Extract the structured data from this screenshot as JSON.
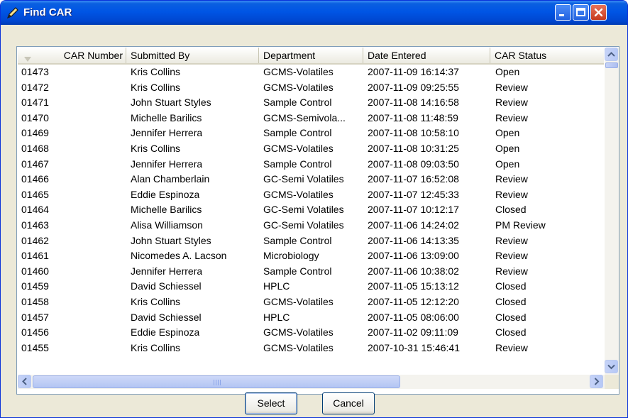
{
  "window": {
    "title": "Find CAR"
  },
  "columns": [
    "CAR Number",
    "Submitted By",
    "Department",
    "Date Entered",
    "CAR Status"
  ],
  "rows": [
    [
      "01473",
      "Kris Collins",
      "GCMS-Volatiles",
      "2007-11-09 16:14:37",
      "Open"
    ],
    [
      "01472",
      "Kris Collins",
      "GCMS-Volatiles",
      "2007-11-09 09:25:55",
      "Review"
    ],
    [
      "01471",
      "John Stuart Styles",
      "Sample Control",
      "2007-11-08 14:16:58",
      "Review"
    ],
    [
      "01470",
      "Michelle Barilics",
      "GCMS-Semivola...",
      "2007-11-08 11:48:59",
      "Review"
    ],
    [
      "01469",
      "Jennifer Herrera",
      "Sample Control",
      "2007-11-08 10:58:10",
      "Open"
    ],
    [
      "01468",
      "Kris Collins",
      "GCMS-Volatiles",
      "2007-11-08 10:31:25",
      "Open"
    ],
    [
      "01467",
      "Jennifer Herrera",
      "Sample Control",
      "2007-11-08 09:03:50",
      "Open"
    ],
    [
      "01466",
      "Alan Chamberlain",
      "GC-Semi Volatiles",
      "2007-11-07 16:52:08",
      "Review"
    ],
    [
      "01465",
      "Eddie Espinoza",
      "GCMS-Volatiles",
      "2007-11-07 12:45:33",
      "Review"
    ],
    [
      "01464",
      "Michelle Barilics",
      "GC-Semi Volatiles",
      "2007-11-07 10:12:17",
      "Closed"
    ],
    [
      "01463",
      "Alisa Williamson",
      "GC-Semi Volatiles",
      "2007-11-06 14:24:02",
      "PM Review"
    ],
    [
      "01462",
      "John Stuart Styles",
      "Sample Control",
      "2007-11-06 14:13:35",
      "Review"
    ],
    [
      "01461",
      "Nicomedes A. Lacson",
      "Microbiology",
      "2007-11-06 13:09:00",
      "Review"
    ],
    [
      "01460",
      "Jennifer Herrera",
      "Sample Control",
      "2007-11-06 10:38:02",
      "Review"
    ],
    [
      "01459",
      "David Schiessel",
      "HPLC",
      "2007-11-05 15:13:12",
      "Closed"
    ],
    [
      "01458",
      "Kris Collins",
      "GCMS-Volatiles",
      "2007-11-05 12:12:20",
      "Closed"
    ],
    [
      "01457",
      "David Schiessel",
      "HPLC",
      "2007-11-05 08:06:00",
      "Closed"
    ],
    [
      "01456",
      "Eddie Espinoza",
      "GCMS-Volatiles",
      "2007-11-02 09:11:09",
      "Closed"
    ],
    [
      "01455",
      "Kris Collins",
      "GCMS-Volatiles",
      "2007-10-31 15:46:41",
      "Review"
    ]
  ],
  "buttons": {
    "select": "Select",
    "cancel": "Cancel"
  },
  "icons": {
    "title": "pencil-icon",
    "minimize": "minimize-icon",
    "maximize": "maximize-icon",
    "close": "close-icon"
  },
  "colors": {
    "titlebar": "#0055e5",
    "window_bg": "#ece9d8",
    "list_border": "#7f9db9"
  }
}
